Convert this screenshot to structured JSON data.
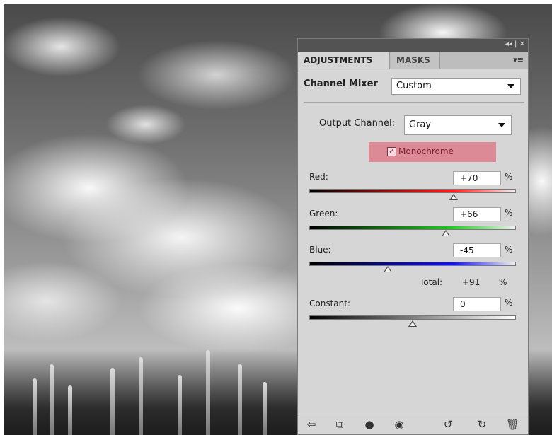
{
  "panel": {
    "tabs": [
      {
        "label": "ADJUSTMENTS"
      },
      {
        "label": "MASKS"
      }
    ],
    "title": "Channel Mixer",
    "preset": {
      "value": "Custom"
    },
    "output_channel": {
      "label": "Output Channel:",
      "value": "Gray"
    },
    "monochrome": {
      "label": "Monochrome",
      "checked": true,
      "highlight_color": "#dc8a96"
    },
    "sliders": [
      {
        "label": "Red:",
        "value": "+70",
        "unit": "%",
        "level": 0.7,
        "gradient": [
          "#000000",
          "#ff2020"
        ]
      },
      {
        "label": "Green:",
        "value": "+66",
        "unit": "%",
        "level": 0.66,
        "gradient": [
          "#000000",
          "#20d020"
        ]
      },
      {
        "label": "Blue:",
        "value": "-45",
        "unit": "%",
        "level": 0.38,
        "gradient": [
          "#000000",
          "#1010ff"
        ]
      }
    ],
    "total": {
      "label": "Total:",
      "value": "+91",
      "unit": "%"
    },
    "constant": {
      "label": "Constant:",
      "value": "0",
      "unit": "%",
      "level": 0.5
    },
    "window_controls": "◂◂ | ✕",
    "bottom_icons": [
      "back-arrow-icon",
      "clip-to-layer-icon",
      "layer-visibility-icon",
      "eye-icon",
      "reset-previous-icon",
      "reset-icon",
      "trash-icon"
    ]
  }
}
